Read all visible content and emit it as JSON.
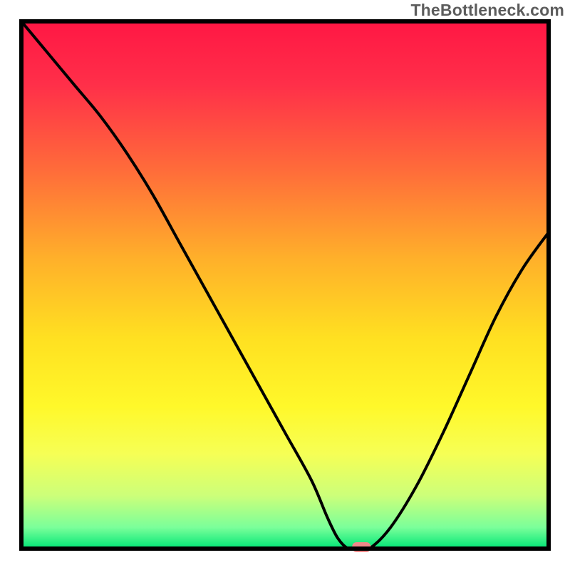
{
  "watermark": "TheBottleneck.com",
  "chart_data": {
    "type": "line",
    "title": "",
    "xlabel": "",
    "ylabel": "",
    "xlim": [
      0,
      100
    ],
    "ylim": [
      0,
      100
    ],
    "x": [
      0,
      5,
      10,
      15,
      20,
      25,
      30,
      35,
      40,
      45,
      50,
      55,
      58,
      60,
      62,
      64,
      66,
      70,
      75,
      80,
      85,
      90,
      95,
      100
    ],
    "values": [
      100,
      94,
      88,
      82,
      75,
      67,
      58,
      49,
      40,
      31,
      22,
      13,
      6,
      2,
      0,
      0,
      0,
      4,
      12,
      22,
      33,
      44,
      53,
      60
    ],
    "optimum_marker": {
      "x": 64.5,
      "y": 0
    },
    "background_gradient": {
      "stops": [
        {
          "offset": 0.0,
          "color": "#ff1744"
        },
        {
          "offset": 0.12,
          "color": "#ff2f49"
        },
        {
          "offset": 0.28,
          "color": "#ff6b3a"
        },
        {
          "offset": 0.45,
          "color": "#ffb02a"
        },
        {
          "offset": 0.6,
          "color": "#ffe021"
        },
        {
          "offset": 0.73,
          "color": "#fff82a"
        },
        {
          "offset": 0.82,
          "color": "#f6ff55"
        },
        {
          "offset": 0.9,
          "color": "#ccff7a"
        },
        {
          "offset": 0.96,
          "color": "#7aff9a"
        },
        {
          "offset": 1.0,
          "color": "#00e676"
        }
      ]
    },
    "frame_color": "#000000",
    "curve_color": "#000000",
    "marker_color": "#f08a8a"
  }
}
